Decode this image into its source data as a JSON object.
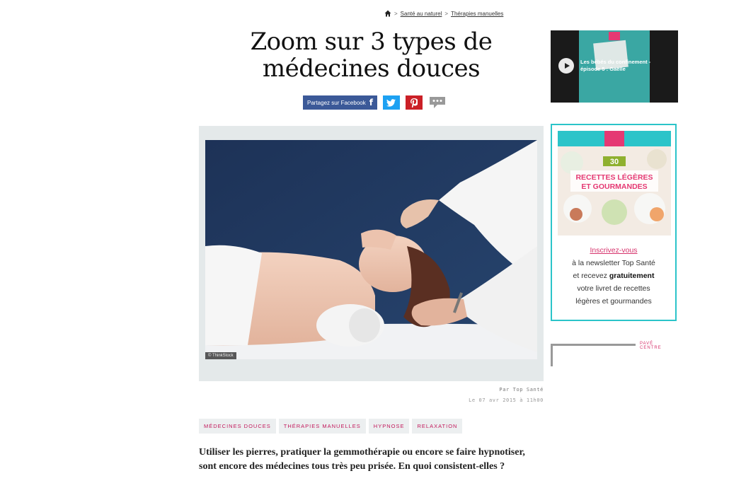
{
  "breadcrumb": {
    "home_icon": "home-icon",
    "items": [
      "Santé au naturel",
      "Thérapies manuelles"
    ]
  },
  "title": "Zoom sur 3 types de médecines douces",
  "share": {
    "facebook_label": "Partagez sur Facebook",
    "facebook_glyph": "f",
    "twitter_icon": "twitter-icon",
    "pinterest_icon": "pinterest-icon",
    "comment_icon": "comment-icon"
  },
  "hero": {
    "credit": "© ThinkStock"
  },
  "article": {
    "author": "Par Top Santé",
    "date": "Le 07 avr 2015 à 11h00",
    "tags": [
      "MÉDECINES DOUCES",
      "THÉRAPIES MANUELLES",
      "HYPNOSE",
      "RELAXATION"
    ],
    "intro": "Utiliser les pierres, pratiquer la gemmothérapie ou encore se faire hypnotiser, sont encore des médecines tous très peu prisée. En quoi consistent-elles ?"
  },
  "video": {
    "title": "Les bébés du confinement - épisode 5 : Gaëlle",
    "play_icon": "play-icon"
  },
  "newsletter": {
    "badge_number": "30",
    "headline_1": "RECETTES LÉGÈRES",
    "headline_2": "ET GOURMANDES",
    "link": "Inscrivez-vous",
    "line1": "à la newsletter Top Santé",
    "line2_pre": "et recevez ",
    "line2_bold": "gratuitement",
    "line3": "votre livret de recettes",
    "line4": "légères et gourmandes"
  },
  "pave": {
    "label": "PAVÉ CENTRE"
  },
  "colors": {
    "accent_pink": "#d6336c",
    "teal": "#2bc4c9",
    "facebook": "#3b5998",
    "twitter": "#1da1f2",
    "pinterest": "#cb2027"
  }
}
